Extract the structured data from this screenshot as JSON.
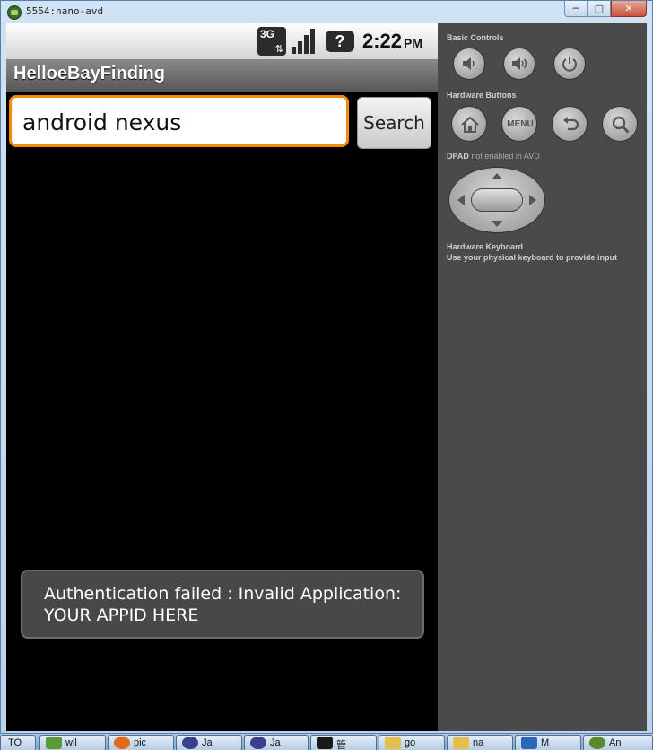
{
  "window": {
    "title": "5554:nano-avd",
    "buttons": {
      "minimize": "─",
      "maximize": "□",
      "close": "✕"
    }
  },
  "statusbar": {
    "network": "3G",
    "help": "?",
    "time": "2:22",
    "ampm": "PM"
  },
  "app": {
    "title": "HelloeBayFinding"
  },
  "search": {
    "value": "android nexus",
    "button_label": "Search"
  },
  "toast": {
    "message": "Authentication failed : Invalid Application: YOUR APPID HERE"
  },
  "panel": {
    "basic_controls": "Basic Controls",
    "hardware_buttons": "Hardware Buttons",
    "menu_label": "MENU",
    "dpad": "DPAD",
    "dpad_note": "not enabled in AVD",
    "keyboard_title": "Hardware Keyboard",
    "keyboard_note": "Use your physical keyboard to provide input"
  },
  "taskbar": {
    "items": [
      {
        "label": "TO",
        "icon": "app-icon",
        "color": "#6e8fb4"
      },
      {
        "label": "wil",
        "icon": "network-icon",
        "color": "#5a9a3a"
      },
      {
        "label": "pic",
        "icon": "firefox-icon",
        "color": "#e06a1a"
      },
      {
        "label": "Ja",
        "icon": "eclipse-icon",
        "color": "#3b3f8f"
      },
      {
        "label": "Ja",
        "icon": "eclipse-icon",
        "color": "#3b3f8f"
      },
      {
        "label": "管",
        "icon": "terminal-icon",
        "color": "#1a1a1a"
      },
      {
        "label": "go",
        "icon": "folder-icon",
        "color": "#e4c04a"
      },
      {
        "label": "na",
        "icon": "folder-icon",
        "color": "#e4c04a"
      },
      {
        "label": "M",
        "icon": "mb-icon",
        "color": "#2c66b8"
      },
      {
        "label": "An",
        "icon": "android-icon",
        "color": "#5a8a2a"
      }
    ]
  }
}
